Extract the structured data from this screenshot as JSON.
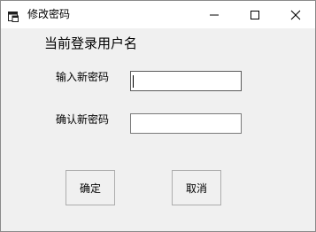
{
  "window": {
    "title": "修改密码",
    "icon": "form-window-icon"
  },
  "titlebar_buttons": {
    "minimize_icon": "minimize-icon",
    "maximize_icon": "maximize-icon",
    "close_icon": "close-icon"
  },
  "form": {
    "username_label": "当前登录用户名",
    "new_password_label": "输入新密码",
    "new_password_value": "",
    "confirm_password_label": "确认新密码",
    "confirm_password_value": ""
  },
  "buttons": {
    "ok_label": "确定",
    "cancel_label": "取消"
  }
}
